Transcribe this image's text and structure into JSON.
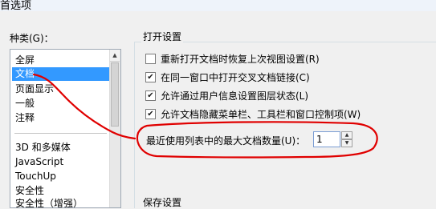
{
  "window": {
    "title": "首选项"
  },
  "categories": {
    "label": "种类(G)：",
    "items": [
      {
        "label": "全屏",
        "selected": false
      },
      {
        "label": "文档",
        "selected": true
      },
      {
        "label": "页面显示",
        "selected": false
      },
      {
        "label": "一般",
        "selected": false
      },
      {
        "label": "注释",
        "selected": false
      },
      {
        "label": "3D 和多媒体",
        "selected": false
      },
      {
        "label": "JavaScript",
        "selected": false
      },
      {
        "label": "TouchUp",
        "selected": false
      },
      {
        "label": "安全性",
        "selected": false
      },
      {
        "label": "安全性（增强）",
        "selected": false
      }
    ]
  },
  "open_settings": {
    "title": "打开设置",
    "options": [
      {
        "label": "重新打开文档时恢复上次视图设置(R)",
        "checked": false
      },
      {
        "label": "在同一窗口中打开交叉文档链接(C)",
        "checked": true
      },
      {
        "label": "允许通过用户信息设置图层状态(L)",
        "checked": true
      },
      {
        "label": "允许文档隐藏菜单栏、工具栏和窗口控制项(W)",
        "checked": true
      }
    ],
    "max_docs_label": "最近使用列表中的最大文档数量(U)：",
    "max_docs_value": "1"
  },
  "save_settings": {
    "title": "保存设置"
  },
  "icons": {
    "checkmark": "✔",
    "spin_up": "▲",
    "spin_down": "▼",
    "scroll_up": "▲"
  },
  "colors": {
    "selection": "#3399ff",
    "annotation": "#e00000"
  }
}
